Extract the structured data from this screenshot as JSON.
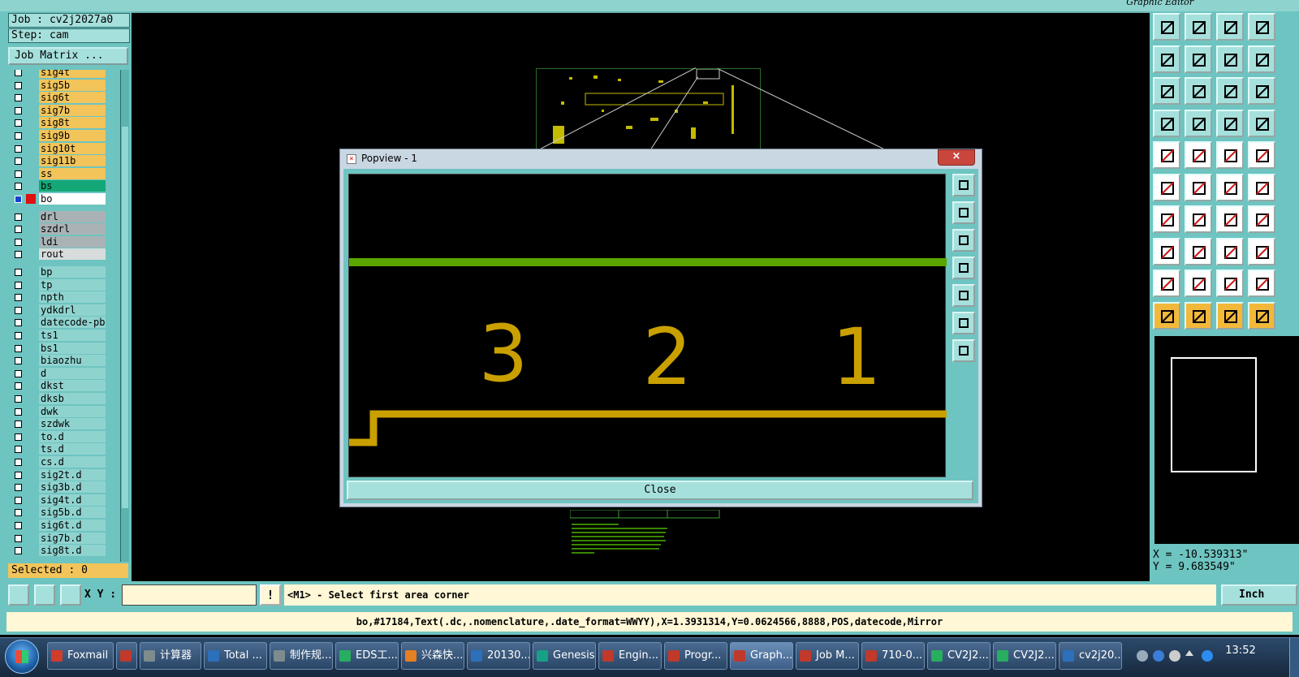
{
  "window": {
    "editor_title": "Graphic Editor"
  },
  "left_panel": {
    "job": "Job : cv2j2027a0",
    "step": "Step: cam",
    "job_matrix_label": "Job Matrix ...",
    "selected": "Selected : 0",
    "layers": [
      {
        "name": "sig4t",
        "color": "#f2c45a",
        "mark": "↲"
      },
      {
        "name": "sig5b",
        "color": "#f2c45a",
        "mark": "↲"
      },
      {
        "name": "sig6t",
        "color": "#f2c45a",
        "mark": "↲"
      },
      {
        "name": "sig7b",
        "color": "#f2c45a",
        "mark": "↲"
      },
      {
        "name": "sig8t",
        "color": "#f2c45a",
        "mark": "↲"
      },
      {
        "name": "sig9b",
        "color": "#f2c45a",
        "mark": "↲"
      },
      {
        "name": "sig10t",
        "color": "#f2c45a",
        "mark": "↲"
      },
      {
        "name": "sig11b",
        "color": "#f2c45a",
        "mark": "↲"
      },
      {
        "name": "ss",
        "color": "#f2c45a",
        "mark": "↲"
      },
      {
        "name": "bs",
        "color": "#14a878",
        "mark": ""
      },
      {
        "name": "bo",
        "color": "#ffffff",
        "mark": "↲≡",
        "active": true
      },
      {
        "name": "drl",
        "color": "#a9b3b6",
        "mark": ""
      },
      {
        "name": "szdrl",
        "color": "#a9b3b6",
        "mark": ""
      },
      {
        "name": "ldi",
        "color": "#a9b3b6",
        "mark": ""
      },
      {
        "name": "rout",
        "color": "#d8dcdd",
        "mark": ""
      },
      {
        "name": "bp",
        "color": "#8fd3cf",
        "mark": "↲"
      },
      {
        "name": "tp",
        "color": "#8fd3cf",
        "mark": ""
      },
      {
        "name": "npth",
        "color": "#8fd3cf",
        "mark": ""
      },
      {
        "name": "ydkdrl",
        "color": "#8fd3cf",
        "mark": ""
      },
      {
        "name": "datecode-pb",
        "color": "#8fd3cf",
        "mark": ""
      },
      {
        "name": "ts1",
        "color": "#8fd3cf",
        "mark": ""
      },
      {
        "name": "bs1",
        "color": "#8fd3cf",
        "mark": ""
      },
      {
        "name": "biaozhu",
        "color": "#8fd3cf",
        "mark": ""
      },
      {
        "name": "d",
        "color": "#8fd3cf",
        "mark": ""
      },
      {
        "name": "dkst",
        "color": "#8fd3cf",
        "mark": ""
      },
      {
        "name": "dksb",
        "color": "#8fd3cf",
        "mark": ""
      },
      {
        "name": "dwk",
        "color": "#8fd3cf",
        "mark": ""
      },
      {
        "name": "szdwk",
        "color": "#8fd3cf",
        "mark": ""
      },
      {
        "name": "to.d",
        "color": "#8fd3cf",
        "mark": "↲"
      },
      {
        "name": "ts.d",
        "color": "#8fd3cf",
        "mark": "↲"
      },
      {
        "name": "cs.d",
        "color": "#8fd3cf",
        "mark": "↲"
      },
      {
        "name": "sig2t.d",
        "color": "#8fd3cf",
        "mark": "↲"
      },
      {
        "name": "sig3b.d",
        "color": "#8fd3cf",
        "mark": "↲"
      },
      {
        "name": "sig4t.d",
        "color": "#8fd3cf",
        "mark": "↲"
      },
      {
        "name": "sig5b.d",
        "color": "#8fd3cf",
        "mark": "↲"
      },
      {
        "name": "sig6t.d",
        "color": "#8fd3cf",
        "mark": "↲"
      },
      {
        "name": "sig7b.d",
        "color": "#8fd3cf",
        "mark": "↲"
      },
      {
        "name": "sig8t.d",
        "color": "#8fd3cf",
        "mark": "↲"
      }
    ]
  },
  "popview": {
    "title": "Popview - 1",
    "close_x": "×",
    "close_button": "Close",
    "digits": [
      "3",
      "2",
      "1"
    ],
    "colors": {
      "line_green": "#5aa500",
      "text_gold": "#c9a000"
    }
  },
  "right_panel": {
    "coord_x": "X = -10.539313\"",
    "coord_y": "Y = 9.683549\""
  },
  "command_bar": {
    "xy_label": "X Y :",
    "xy_value": "",
    "warn": "!",
    "prompt": "<M1> - Select first area corner",
    "units": "Inch"
  },
  "status_line": "bo,#17184,Text(.dc,.nomenclature,.date_format=WWYY),X=1.3931314,Y=0.0624566,8888,POS,datecode,Mirror",
  "taskbar": {
    "items": [
      {
        "label": "Foxmail",
        "color": "#d23c2a"
      },
      {
        "label": "",
        "color": "#c0392b"
      },
      {
        "label": "计算器",
        "color": "#7f8c8d"
      },
      {
        "label": "Total ...",
        "color": "#2c6fbb"
      },
      {
        "label": "制作规...",
        "color": "#7f8c8d"
      },
      {
        "label": "EDS工...",
        "color": "#27ae60"
      },
      {
        "label": "兴森快...",
        "color": "#e67e22"
      },
      {
        "label": "20130...",
        "color": "#2c6fbb"
      },
      {
        "label": "Genesis",
        "color": "#16a085"
      },
      {
        "label": "Engin...",
        "color": "#c0392b"
      },
      {
        "label": "Progr...",
        "color": "#c0392b"
      },
      {
        "label": "Graph...",
        "color": "#c0392b",
        "active": true
      },
      {
        "label": "Job M...",
        "color": "#c0392b"
      },
      {
        "label": "710-0...",
        "color": "#c0392b"
      },
      {
        "label": "CV2J2...",
        "color": "#27ae60"
      },
      {
        "label": "CV2J2...",
        "color": "#27ae60"
      },
      {
        "label": "cv2j20...",
        "color": "#2c6fbb"
      }
    ],
    "clock": "13:52"
  }
}
